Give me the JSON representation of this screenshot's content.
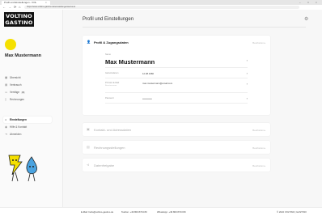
{
  "browser": {
    "tab_title": "Profil und Einstellungen - VOL",
    "tab_close": "×",
    "url": "https://www.voltino-gastino.de/einstellungen/account",
    "back": "←",
    "forward": "→",
    "reload": "⟳",
    "home": "⌂",
    "window_min": "–",
    "window_max": "□",
    "window_close": "×"
  },
  "brand": {
    "logo_line1": "VOLTINO",
    "logo_line2": "GASTINO",
    "avatar_color": "#f5e000"
  },
  "user": {
    "name": "Max Mustermann"
  },
  "sidebar": {
    "items": [
      {
        "label": "Übersicht",
        "icon": "grid-icon"
      },
      {
        "label": "Verbrauch",
        "icon": "chart-icon"
      },
      {
        "label": "Verträge",
        "badge": "33",
        "icon": "document-icon"
      },
      {
        "label": "Rechnungen",
        "icon": "invoice-icon"
      },
      {
        "label": "Einstellungen",
        "icon": "gear-icon",
        "active": true
      },
      {
        "label": "Hilfe & Kontakt",
        "icon": "help-icon"
      },
      {
        "label": "Abmelden",
        "icon": "logout-icon"
      }
    ]
  },
  "main": {
    "title": "Profil und Einstellungen",
    "cards": {
      "profile": {
        "title": "Profil & Zugangsdaten",
        "action": "Bearbeiten ▸",
        "fields": {
          "name_label": "Name",
          "name_value": "Max Mustermann",
          "birthday_label": "Geburtsdatum",
          "birthday_value": "12.08.1980",
          "email_label": "Primäre E-Mail",
          "email_sublabel": "Benutzername",
          "email_value": "max.mustermann@email.com",
          "password_label": "Passwort",
          "password_value": "••••••••••••"
        }
      },
      "contact": {
        "title": "Kontakt- und Adressdaten",
        "action": "Bearbeiten ▸"
      },
      "billing": {
        "title": "Rechnungsstellungen",
        "action": "Bearbeiten ▸"
      },
      "consent": {
        "title": "Datenfreigabe",
        "action": "Bearbeiten ▸"
      }
    }
  },
  "footer": {
    "email": "E-Mail: hello@voltino-gastino.de",
    "phone": "Telefon: +49 800 8723 80",
    "whatsapp": "WhatsApp: +49 800 8723 80",
    "copyright": "© 2022 VOLTINO | GASTINO"
  }
}
